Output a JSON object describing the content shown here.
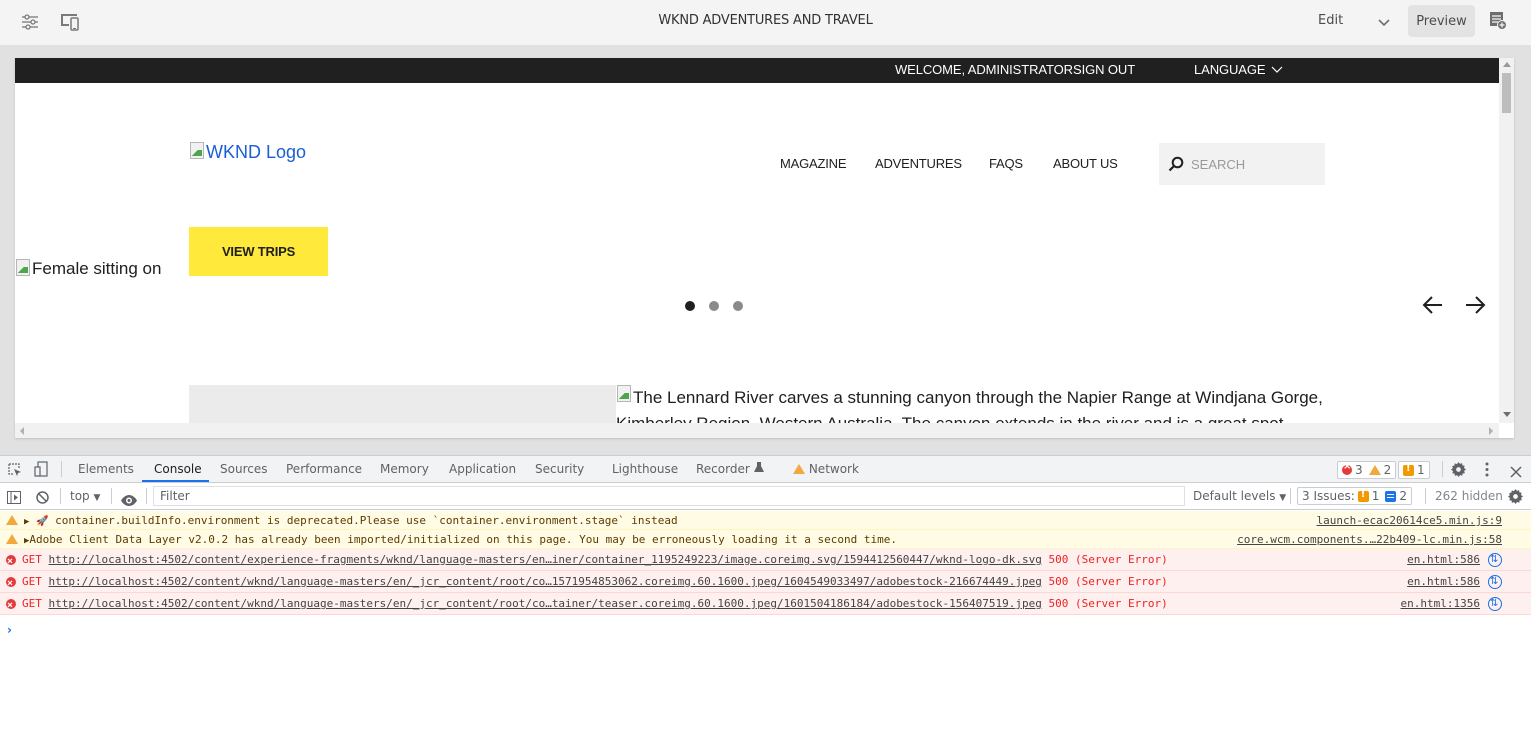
{
  "editor": {
    "title": "WKND ADVENTURES AND TRAVEL",
    "mode_label": "Edit",
    "preview_label": "Preview",
    "icons": [
      "page-properties-icon",
      "emulator-icon",
      "chevron-down-icon",
      "annotations-icon"
    ]
  },
  "site": {
    "utility": {
      "welcome": "WELCOME, ADMINISTRATOR",
      "sign_out": "SIGN OUT",
      "language": "LANGUAGE"
    },
    "logo_alt": "WKND Logo",
    "nav": [
      "MAGAZINE",
      "ADVENTURES",
      "FAQS",
      "ABOUT US"
    ],
    "search_placeholder": "SEARCH",
    "hero_alt": "Female sitting on",
    "cta_label": "VIEW TRIPS",
    "carousel": {
      "slides": 3,
      "active_index": 0
    },
    "teaser_alt_line1": "The Lennard River carves a stunning canyon through the Napier Range at Windjana Gorge,",
    "teaser_alt_line2": "Kimberley Region, Western Australia. The canyon extends in the river and is a great spot",
    "colors": {
      "cta": "#ffea3c",
      "utility_bar": "#202020",
      "link": "#1a5fd6"
    }
  },
  "devtools": {
    "tabs": [
      "Elements",
      "Console",
      "Sources",
      "Performance",
      "Memory",
      "Application",
      "Security",
      "Lighthouse",
      "Recorder",
      "Network"
    ],
    "active_tab": "Console",
    "counts": {
      "errors": "3",
      "warnings": "2",
      "issues": "1"
    },
    "context": "top",
    "filter_placeholder": "Filter",
    "levels": "Default levels",
    "issues_label": "3 Issues:",
    "issues_warn": "1",
    "issues_info": "2",
    "hidden": "262 hidden",
    "messages": [
      {
        "level": "warning",
        "prefix": "▶ 🚀",
        "text": "container.buildInfo.environment is deprecated.Please use `container.environment.stage` instead",
        "source": "launch-ecac20614ce5.min.js:9"
      },
      {
        "level": "warning",
        "prefix": "▶",
        "text": "Adobe Client Data Layer v2.0.2 has already been imported/initialized on this page. You may be erroneously loading it a second time.",
        "source": "core.wcm.components.…22b409-lc.min.js:58"
      },
      {
        "level": "error",
        "method": "GET",
        "url": "http://localhost:4502/content/experience-fragments/wknd/language-masters/en…iner/container_1195249223/image.coreimg.svg/1594412560447/wknd-logo-dk.svg",
        "status": "500 (Server Error)",
        "source": "en.html:586"
      },
      {
        "level": "error",
        "method": "GET",
        "url": "http://localhost:4502/content/wknd/language-masters/en/_jcr_content/root/co…1571954853062.coreimg.60.1600.jpeg/1604549033497/adobestock-216674449.jpeg",
        "status": "500 (Server Error)",
        "source": "en.html:586"
      },
      {
        "level": "error",
        "method": "GET",
        "url": "http://localhost:4502/content/wknd/language-masters/en/_jcr_content/root/co…tainer/teaser.coreimg.60.1600.jpeg/1601504186184/adobestock-156407519.jpeg",
        "status": "500 (Server Error)",
        "source": "en.html:1356"
      }
    ],
    "prompt": "›"
  }
}
